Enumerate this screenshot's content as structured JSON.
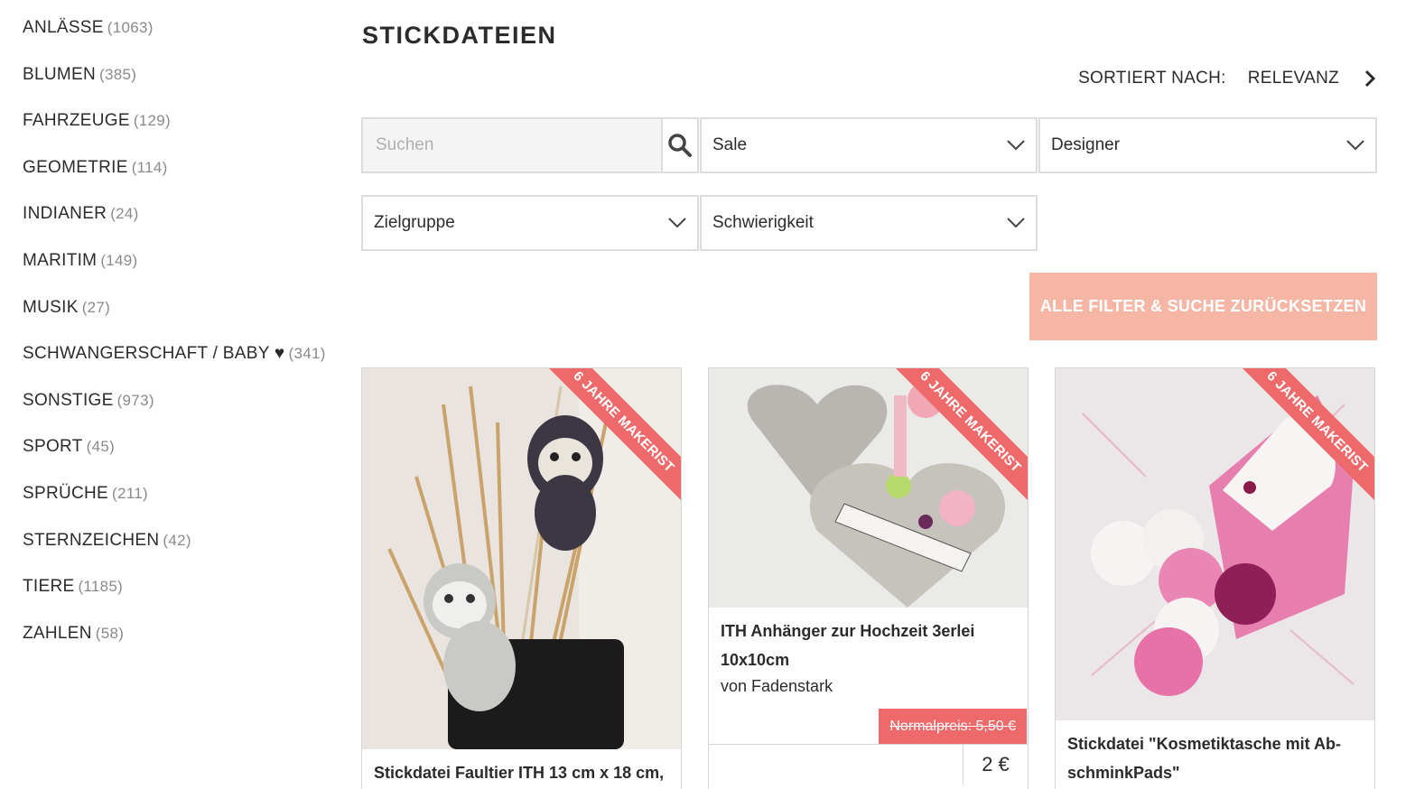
{
  "sidebar": {
    "categories": [
      {
        "name": "ANLÄSSE",
        "count": "(1063)"
      },
      {
        "name": "BLUMEN",
        "count": "(385)"
      },
      {
        "name": "FAHRZEUGE",
        "count": "(129)"
      },
      {
        "name": "GEOMETRIE",
        "count": "(114)"
      },
      {
        "name": "INDIANER",
        "count": "(24)"
      },
      {
        "name": "MARITIM",
        "count": "(149)"
      },
      {
        "name": "MUSIK",
        "count": "(27)"
      },
      {
        "name": "SCHWANGERSCHAFT / BABY ♥",
        "count": "(341)"
      },
      {
        "name": "SONSTIGE",
        "count": "(973)"
      },
      {
        "name": "SPORT",
        "count": "(45)"
      },
      {
        "name": "SPRÜCHE",
        "count": "(211)"
      },
      {
        "name": "STERNZEICHEN",
        "count": "(42)"
      },
      {
        "name": "TIERE",
        "count": "(1185)"
      },
      {
        "name": "ZAHLEN",
        "count": "(58)"
      }
    ]
  },
  "main": {
    "title": "STICKDATEIEN",
    "sort_label": "SORTIERT NACH:",
    "sort_value": "RELEVANZ",
    "search_placeholder": "Suchen",
    "filters": {
      "sale": "Sale",
      "designer": "Designer",
      "zielgruppe": "Zielgruppe",
      "schwierigkeit": "Schwierigkeit"
    },
    "reset_label": "ALLE FILTER & SUCHE ZURÜCKSETZEN"
  },
  "products": [
    {
      "ribbon": "6 Jahre Makerist",
      "title": "Stickdatei Faultier ITH 13 cm x 18 cm,"
    },
    {
      "ribbon": "6 Jahre Makerist",
      "title": "ITH Anhänger zur Hochzeit 3erlei 10x10cm",
      "designer": "von Fadenstark",
      "old_price": "Normalpreis: 5,50 €",
      "price": "2 €"
    },
    {
      "ribbon": "6 Jahre Makerist",
      "title": "Stickdatei \"Kosmetiktasche mit Ab­schminkPads\""
    }
  ],
  "colors": {
    "accent_ribbon": "#ee6a6a",
    "reset_button": "#f6b6a5",
    "border": "#dcdcdc"
  }
}
